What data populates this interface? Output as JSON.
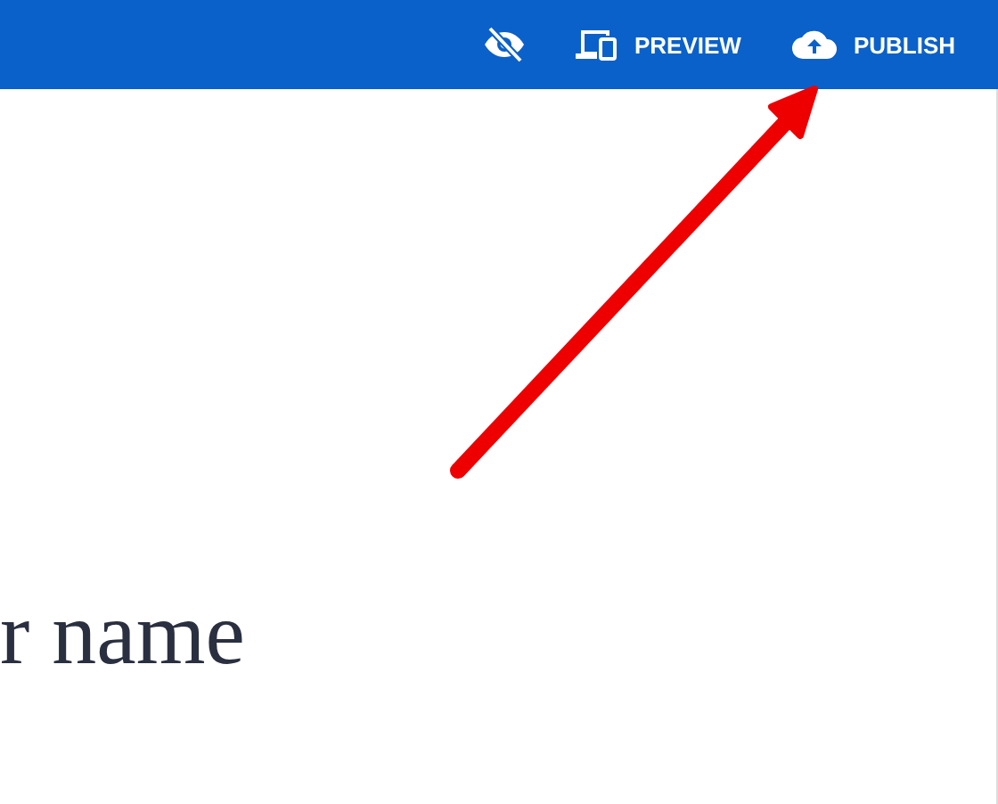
{
  "toolbar": {
    "buttons": [
      {
        "kind": "hide"
      },
      {
        "kind": "preview",
        "label": "PREVIEW"
      },
      {
        "kind": "publish",
        "label": "PUBLISH"
      }
    ]
  },
  "heading": "r name"
}
